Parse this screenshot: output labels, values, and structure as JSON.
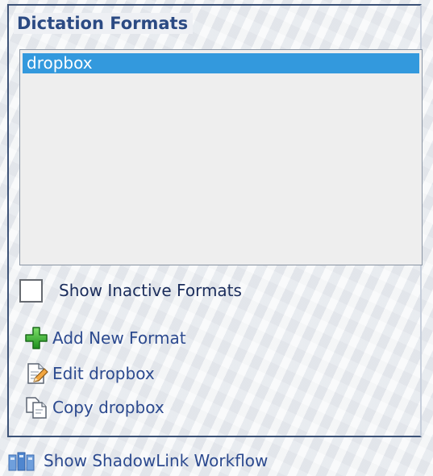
{
  "panel": {
    "legend": "Dictation Formats",
    "formats": [
      {
        "label": "dropbox",
        "selected": true
      }
    ]
  },
  "show_inactive": {
    "label": "Show Inactive Formats",
    "checked": false
  },
  "actions": {
    "add": {
      "label": "Add New Format",
      "icon": "plus-icon"
    },
    "edit": {
      "label": "Edit dropbox",
      "icon": "edit-document-icon"
    },
    "copy": {
      "label": "Copy dropbox",
      "icon": "copy-document-icon"
    }
  },
  "workflow": {
    "label": "Show ShadowLink Workflow",
    "icon": "workflow-icon"
  },
  "colors": {
    "selection": "#3399dd",
    "link": "#2c4a8f",
    "legend": "#2b4a83",
    "border": "#3c5277"
  }
}
